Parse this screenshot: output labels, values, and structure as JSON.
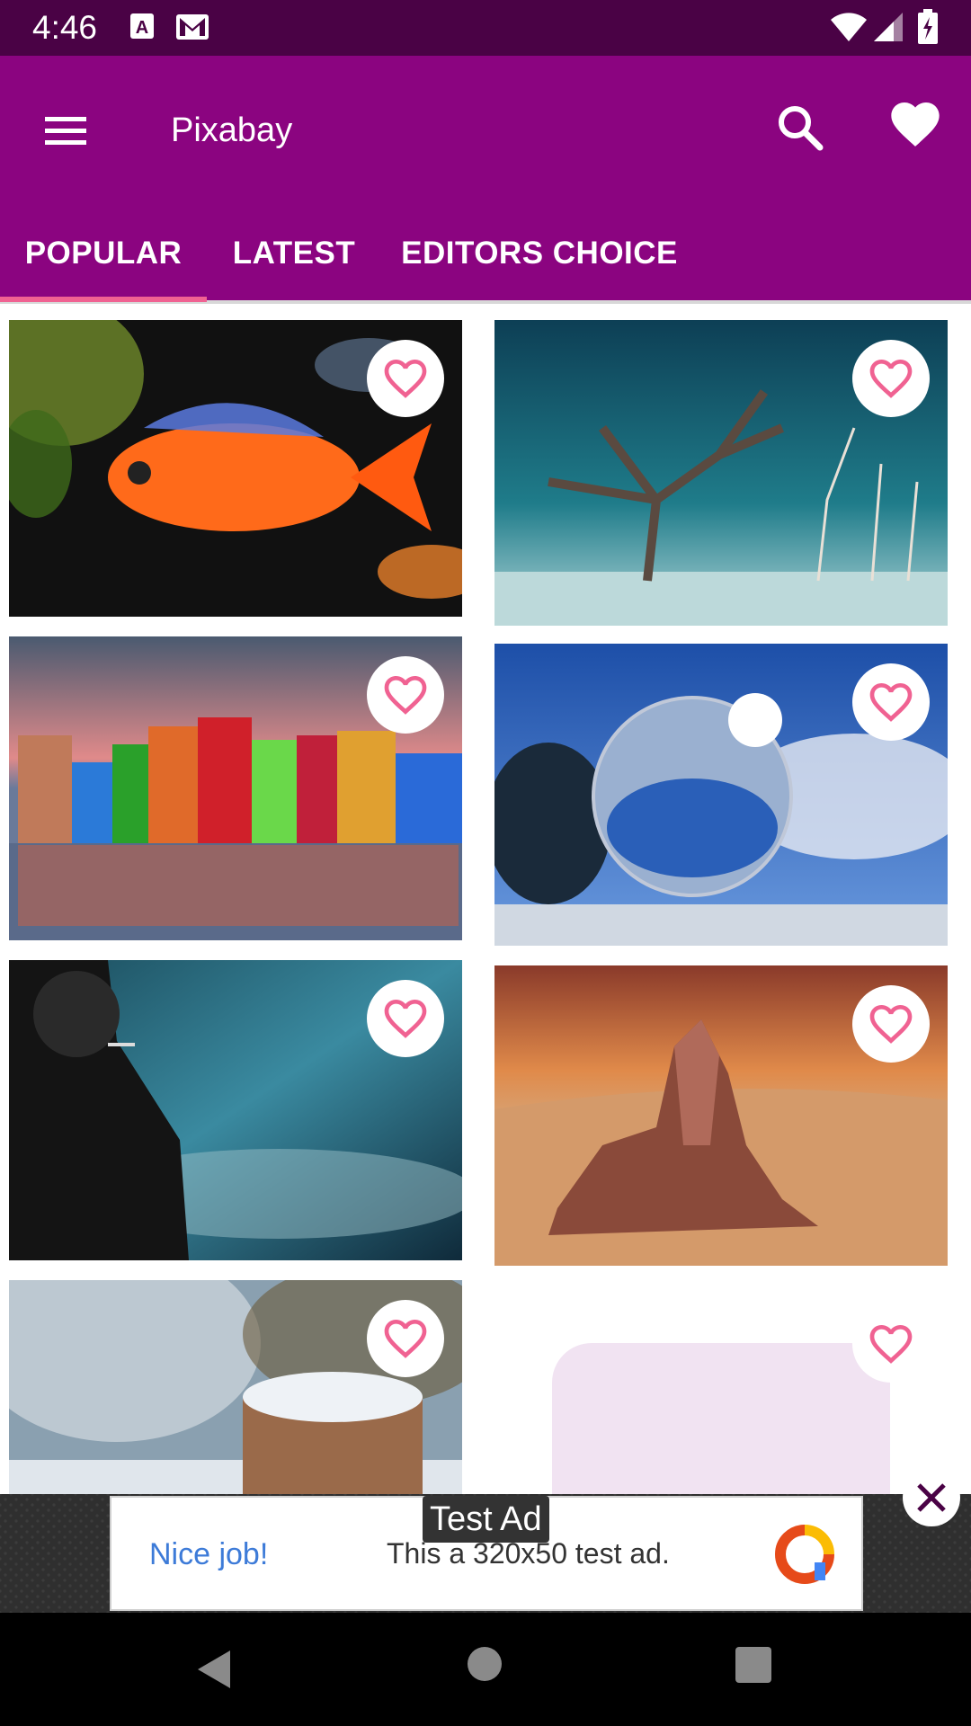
{
  "status_bar": {
    "time": "4:46",
    "icons": [
      "keyboard-a-icon",
      "gmail-icon",
      "wifi-icon",
      "signal-icon",
      "battery-icon"
    ]
  },
  "app_bar": {
    "title": "Pixabay",
    "menu_icon": "menu-icon",
    "search_icon": "search-icon",
    "favorites_icon": "heart-filled-icon",
    "background": "#8b0480"
  },
  "tabs": [
    {
      "label": "POPULAR",
      "selected": true
    },
    {
      "label": "LATEST",
      "selected": false
    },
    {
      "label": "EDITORS CHOICE",
      "selected": false
    }
  ],
  "images": [
    {
      "subject": "orange fish",
      "favorited": false
    },
    {
      "subject": "bare tree in snow",
      "favorited": false
    },
    {
      "subject": "colorful houses reflection",
      "favorited": false
    },
    {
      "subject": "crystal ball in sun",
      "favorited": false
    },
    {
      "subject": "man smoking in rain",
      "favorited": false
    },
    {
      "subject": "desert rock formation",
      "favorited": false
    },
    {
      "subject": "snowy tree stump",
      "favorited": false
    },
    {
      "subject": "loading placeholder",
      "favorited": false
    }
  ],
  "ad": {
    "label": "Test Ad",
    "headline": "Nice job!",
    "text": "This a 320x50 test ad.",
    "close_icon": "close-icon"
  },
  "colors": {
    "accent": "#f06292",
    "status_bar": "#4a0245"
  }
}
